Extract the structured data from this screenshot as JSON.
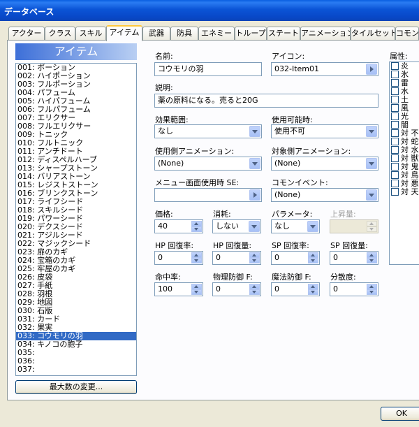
{
  "window": {
    "title": "データベース"
  },
  "tabs": [
    {
      "label": "アクター"
    },
    {
      "label": "クラス"
    },
    {
      "label": "スキル"
    },
    {
      "label": "アイテム"
    },
    {
      "label": "武器"
    },
    {
      "label": "防具"
    },
    {
      "label": "エネミー"
    },
    {
      "label": "トループ"
    },
    {
      "label": "ステート"
    },
    {
      "label": "アニメーション"
    },
    {
      "label": "タイルセット"
    },
    {
      "label": "コモンイベ"
    }
  ],
  "active_tab": "アイテム",
  "list": {
    "header": "アイテム",
    "items": [
      "001: ポーション",
      "002: ハイポーション",
      "003: フルポーション",
      "004: パフューム",
      "005: ハイパフューム",
      "006: フルパフューム",
      "007: エリクサー",
      "008: フルエリクサー",
      "009: トニック",
      "010: フルトニック",
      "011: アンチドート",
      "012: ディスペルハーブ",
      "013: シャープストーン",
      "014: バリアストーン",
      "015: レジストストーン",
      "016: ブリンクストーン",
      "017: ライフシード",
      "018: スキルシード",
      "019: パワーシード",
      "020: デクスシード",
      "021: アジルシード",
      "022: マジックシード",
      "023: 扉のカギ",
      "024: 宝箱のカギ",
      "025: 牢屋のカギ",
      "026: 皮袋",
      "027: 手紙",
      "028: 羽根",
      "029: 地図",
      "030: 石版",
      "031: カード",
      "032: 果実",
      "033: コウモリの羽",
      "034: キノコの胞子",
      "035:",
      "036:",
      "037:"
    ],
    "selected": "033: コウモリの羽",
    "max_button": "最大数の変更..."
  },
  "form": {
    "name_label": "名前:",
    "name_value": "コウモリの羽",
    "icon_label": "アイコン:",
    "icon_value": "032-Item01",
    "desc_label": "説明:",
    "desc_value": "薬の原料になる。売ると20G",
    "scope_label": "効果範囲:",
    "scope_value": "なし",
    "occasion_label": "使用可能時:",
    "occasion_value": "使用不可",
    "user_anim_label": "使用側アニメーション:",
    "user_anim_value": "(None)",
    "target_anim_label": "対象側アニメーション:",
    "target_anim_value": "(None)",
    "menu_se_label": "メニュー画面使用時 SE:",
    "menu_se_value": "",
    "common_event_label": "コモンイベント:",
    "common_event_value": "(None)",
    "price_label": "価格:",
    "price_value": "40",
    "consumable_label": "消耗:",
    "consumable_value": "しない",
    "param_label": "パラメータ:",
    "param_value": "なし",
    "param_inc_label": "上昇量:",
    "param_inc_value": "",
    "hp_rate_label": "HP 回復率:",
    "hp_rate_value": "0",
    "hp_amount_label": "HP 回復量:",
    "hp_amount_value": "0",
    "sp_rate_label": "SP 回復率:",
    "sp_rate_value": "0",
    "sp_amount_label": "SP 回復量:",
    "sp_amount_value": "0",
    "hit_label": "命中率:",
    "hit_value": "100",
    "pdef_label": "物理防御 F:",
    "pdef_value": "0",
    "mdef_label": "魔法防御 F:",
    "mdef_value": "0",
    "variance_label": "分散度:",
    "variance_value": "0"
  },
  "attributes": {
    "label": "属性:",
    "items": [
      "炎",
      "氷",
      "雷",
      "水",
      "土",
      "風",
      "光",
      "闇",
      "対 不",
      "対 蛇",
      "対 水",
      "対 獣",
      "対 鬼",
      "対 鳥",
      "対 悪",
      "対 天"
    ]
  },
  "footer": {
    "ok_label": "OK"
  }
}
